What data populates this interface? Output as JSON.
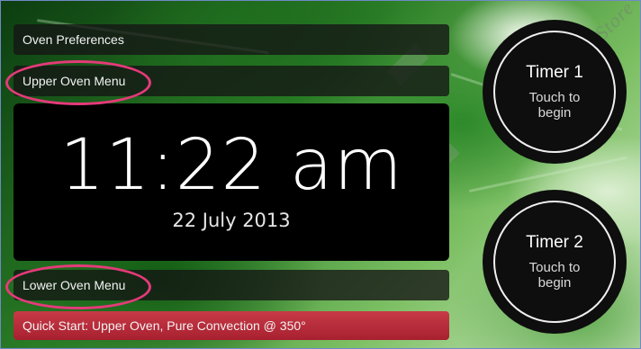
{
  "menu": {
    "oven_preferences": "Oven Preferences",
    "upper_oven_menu": "Upper Oven Menu",
    "lower_oven_menu": "Lower Oven Menu",
    "quick_start": "Quick Start: Upper Oven, Pure Convection @ 350°"
  },
  "clock": {
    "time": "11:22 am",
    "date": "22 July 2013"
  },
  "timers": [
    {
      "title": "Timer 1",
      "subtitle": "Touch to begin"
    },
    {
      "title": "Timer 2",
      "subtitle": "Touch to begin"
    }
  ],
  "watermark": "Thunder Store",
  "colors": {
    "quick_start_bg": "#b52a38",
    "highlight_ring": "#e53a7a",
    "panel_bg": "#000000"
  }
}
